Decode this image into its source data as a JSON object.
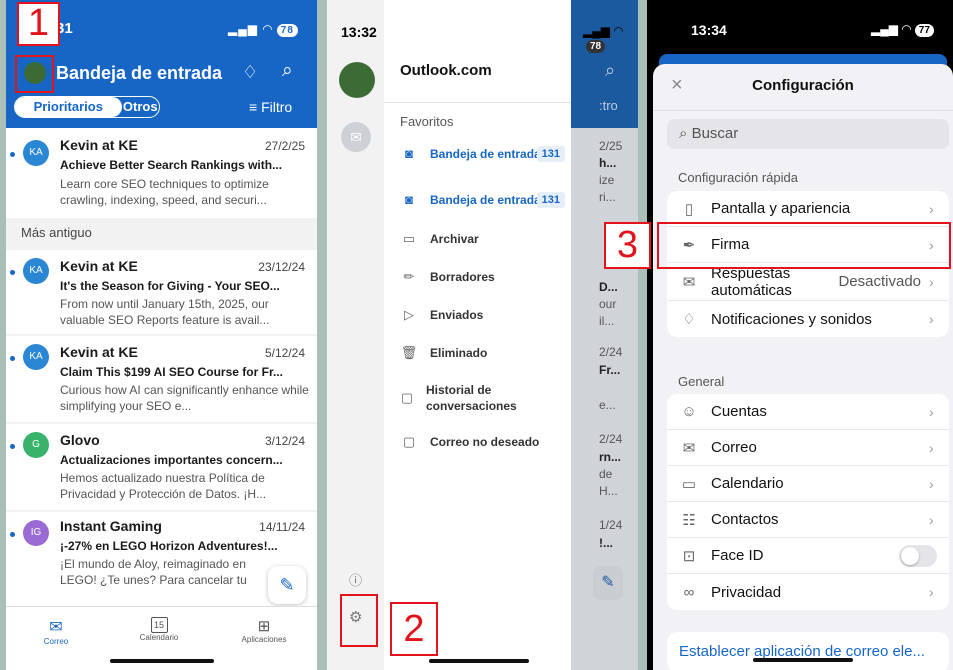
{
  "phone1": {
    "time": ":31",
    "battery": "78",
    "header_title": "Bandeja de entrada",
    "tab_focused": "Prioritarios",
    "tab_other": "Otros",
    "filter_label": "Filtro",
    "section_older": "Más antiguo",
    "emails": [
      {
        "initials": "KA",
        "sender": "Kevin at KE",
        "date": "27/2/25",
        "subject": "Achieve Better Search Rankings with...",
        "preview": "Learn core SEO techniques to optimize crawling, indexing, speed, and securi...",
        "color": "#2b86d3"
      },
      {
        "initials": "KA",
        "sender": "Kevin at KE",
        "date": "23/12/24",
        "subject": "It's the Season for Giving - Your SEO...",
        "preview": "From now until January 15th, 2025, our valuable SEO Reports feature is avail...",
        "color": "#2b86d3"
      },
      {
        "initials": "KA",
        "sender": "Kevin at KE",
        "date": "5/12/24",
        "subject": "Claim This $199 AI SEO Course for Fr...",
        "preview": "Curious how AI can significantly enhance while simplifying your SEO e...",
        "color": "#2b86d3"
      },
      {
        "initials": "G",
        "sender": "Glovo",
        "date": "3/12/24",
        "subject": "Actualizaciones importantes concern...",
        "preview": "Hemos actualizado nuestra Política de Privacidad y Protección de Datos. ¡H...",
        "color": "#39b36b"
      },
      {
        "initials": "IG",
        "sender": "Instant Gaming",
        "date": "14/11/24",
        "subject": "¡-27% en LEGO Horizon Adventures!...",
        "preview": "¡El mundo de Aloy, reimaginado en LEGO! ¿Te unes? Para cancelar tu",
        "color": "#9a6bd4"
      }
    ],
    "tabs": [
      "Correo",
      "Calendario",
      "Aplicaciones"
    ],
    "calendar_day": "15"
  },
  "phone2": {
    "time": "13:32",
    "battery": "78",
    "account": "Outlook.com",
    "favorites_label": "Favoritos",
    "favorites": [
      {
        "label": "Bandeja de entrada",
        "count": "131"
      },
      {
        "label": "Bandeja de entrada",
        "count": "131"
      }
    ],
    "folders": [
      {
        "label": "Archivar",
        "icon": "archive-icon"
      },
      {
        "label": "Borradores",
        "icon": "pencil-icon"
      },
      {
        "label": "Enviados",
        "icon": "send-icon"
      },
      {
        "label": "Eliminado",
        "icon": "trash-icon"
      },
      {
        "label": "Historial de conversaciones",
        "icon": "folder-icon"
      },
      {
        "label": "Correo no deseado",
        "icon": "junk-icon"
      }
    ],
    "strip": [
      ":tro",
      "2/25",
      "h...",
      "ize",
      "ri...",
      "D...",
      "our",
      "il...",
      "2/24",
      "Fr...",
      "e...",
      "2/24",
      "rn...",
      "de",
      "H...",
      "1/24",
      "!..."
    ]
  },
  "phone3": {
    "time": "13:34",
    "battery": "77",
    "title": "Configuración",
    "search_placeholder": "Buscar",
    "quick_label": "Configuración rápida",
    "quick": [
      {
        "label": "Pantalla y apariencia",
        "icon": "phone-icon",
        "value": ""
      },
      {
        "label": "Firma",
        "icon": "signature-icon",
        "value": ""
      },
      {
        "label": "Respuestas automáticas",
        "icon": "auto-reply-icon",
        "value": "Desactivado"
      },
      {
        "label": "Notificaciones y sonidos",
        "icon": "bell-icon",
        "value": ""
      }
    ],
    "general_label": "General",
    "general": [
      {
        "label": "Cuentas",
        "icon": "accounts-icon"
      },
      {
        "label": "Correo",
        "icon": "mail-icon"
      },
      {
        "label": "Calendario",
        "icon": "calendar-icon"
      },
      {
        "label": "Contactos",
        "icon": "contacts-icon"
      },
      {
        "label": "Face ID",
        "icon": "faceid-icon"
      },
      {
        "label": "Privacidad",
        "icon": "privacy-icon"
      }
    ],
    "default_app_link": "Establecer aplicación de correo ele..."
  },
  "annotations": [
    "1",
    "2",
    "3"
  ],
  "colors": {
    "accent": "#1766c6",
    "annotation": "#e4121b"
  }
}
